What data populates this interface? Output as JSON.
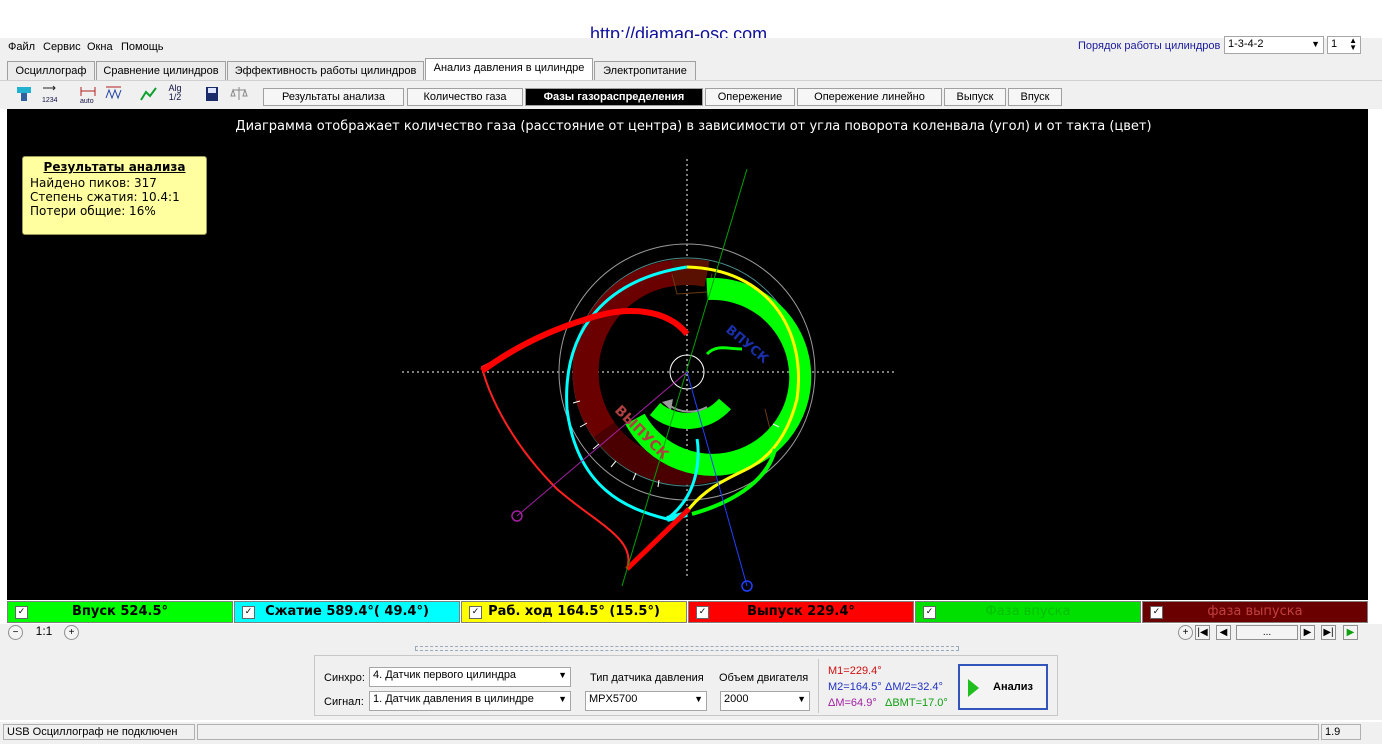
{
  "header": {
    "url": "http://diamag-osc.com"
  },
  "menu": {
    "items": [
      "Файл",
      "Сервис",
      "Окна",
      "Помощь"
    ]
  },
  "cylinder_order": {
    "label": "Порядок работы цилиндров",
    "value": "1-3-4-2",
    "number": "1"
  },
  "tabs": [
    "Осциллограф",
    "Сравнение цилиндров",
    "Эффективность работы цилиндров",
    "Анализ давления в цилиндре",
    "Электропитание"
  ],
  "toolbar": {
    "auto_label": "auto",
    "alg_label": "Alg",
    "alg_sub": "1/2",
    "num_label": "1234"
  },
  "subtabs": [
    "Результаты анализа",
    "Количество газа",
    "Фазы газораспределения",
    "Опережение",
    "Опережение линейно",
    "Выпуск",
    "Впуск"
  ],
  "plot": {
    "caption": "Диаграмма отображает количество газа (расстояние от центра) в зависимости от угла поворота коленвала (угол) и от такта (цвет)",
    "intake_label": "ВПУСК",
    "exhaust_label": "ВЫПУСК"
  },
  "results": {
    "title": "Результаты анализа",
    "peaks": "Найдено пиков: 317",
    "compression": "Степень сжатия: 10.4:1",
    "losses": "Потери общие: 16%"
  },
  "legend": {
    "items": [
      {
        "label": "Впуск 524.5°",
        "bg": "#00ff00",
        "color": "#000000"
      },
      {
        "label": "Сжатие 589.4°( 49.4°)",
        "bg": "#00ffff",
        "color": "#000000"
      },
      {
        "label": "Раб. ход 164.5° (15.5°)",
        "bg": "#ffff00",
        "color": "#000000"
      },
      {
        "label": "Выпуск 229.4°",
        "bg": "#ff0000",
        "color": "#000000"
      },
      {
        "label": "Фаза впуска",
        "bg": "#00e000",
        "color": "#00c000"
      },
      {
        "label": "фаза выпуска",
        "bg": "#6b0000",
        "color": "#c04040"
      }
    ]
  },
  "nav": {
    "zoom": "1:1",
    "dots": "..."
  },
  "controls": {
    "sync_label": "Синхро:",
    "sync_value": "4.  Датчик первого цилиндра",
    "signal_label": "Сигнал:",
    "signal_value": "1.  Датчик давления в цилиндре",
    "sensor_type_label": "Тип датчика давления",
    "sensor_type_value": "MPX5700",
    "volume_label": "Объем двигателя",
    "volume_value": "2000",
    "m1": "M1=229.4°",
    "m2": "M2=164.5°",
    "dm2": "ΔM/2=32.4°",
    "dm": "ΔM=64.9°",
    "dbmt": "ΔВМТ=17.0°",
    "analyze_label": "Анализ"
  },
  "status": {
    "connection": "USB Осциллограф не подключен",
    "version": "1.9"
  },
  "colors": {
    "intake": "#00ff00",
    "compression": "#00ffff",
    "power": "#ffff00",
    "exhaust": "#ff0000"
  }
}
